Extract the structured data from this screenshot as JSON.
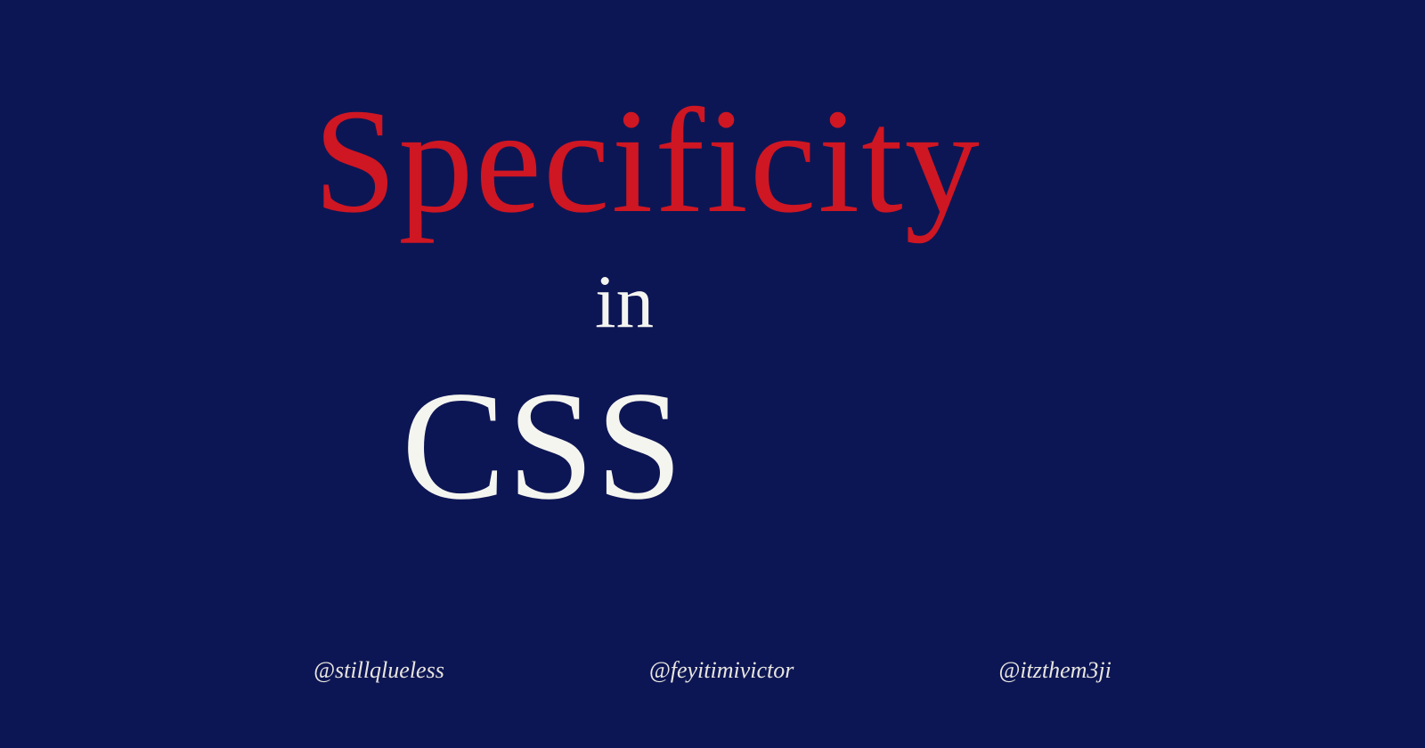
{
  "title": {
    "word1": "Specificity",
    "word2": "in",
    "word3": "CSS"
  },
  "handles": {
    "handle1": "@stillqlueless",
    "handle2": "@feyitimivictor",
    "handle3": "@itzthem3ji"
  }
}
